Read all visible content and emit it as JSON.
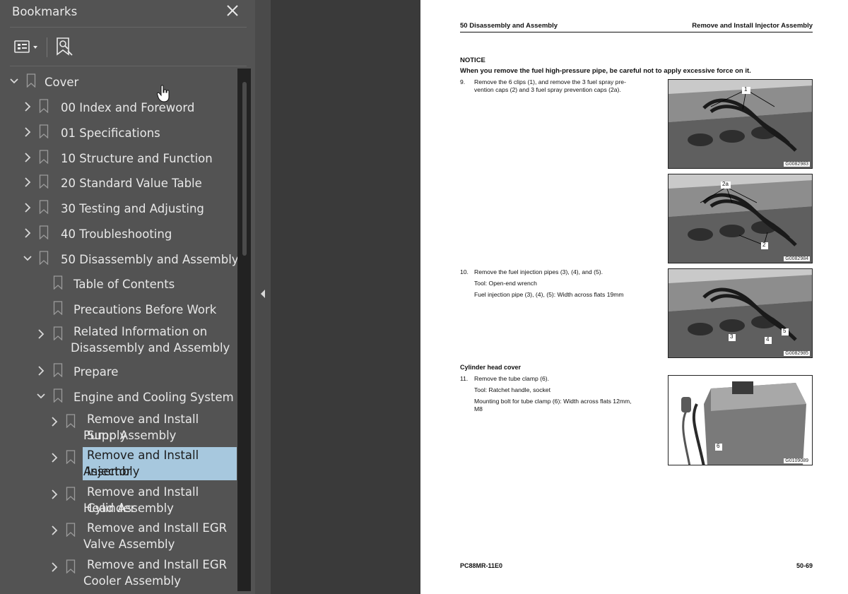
{
  "sidebar": {
    "title": "Bookmarks",
    "close_icon": "close-icon",
    "toolbar": {
      "options_icon": "bookmark-options-icon",
      "find_icon": "find-bookmark-icon"
    }
  },
  "bookmarks": [
    {
      "label": "Cover",
      "expanded": true
    },
    {
      "label": "00 Index and Foreword",
      "expanded": false
    },
    {
      "label": "01 Specifications",
      "expanded": false
    },
    {
      "label": "10 Structure and Function",
      "expanded": false
    },
    {
      "label": "20 Standard Value Table",
      "expanded": false
    },
    {
      "label": "30 Testing and Adjusting",
      "expanded": false
    },
    {
      "label": "40 Troubleshooting",
      "expanded": false
    },
    {
      "label": "50 Disassembly and Assembly",
      "expanded": true
    },
    {
      "label": "Table of Contents"
    },
    {
      "label": "Precautions Before Work"
    },
    {
      "label": "Related Information on Disassembly and Assembly",
      "line1": "Related Information on",
      "line2": "Disassembly and Assembly",
      "expanded": false
    },
    {
      "label": "Prepare",
      "expanded": false
    },
    {
      "label": "Engine and Cooling System",
      "expanded": true
    },
    {
      "line1": "Remove and Install Supply",
      "line2": "Pump Assembly",
      "expanded": false
    },
    {
      "line1": "Remove and Install Injector",
      "line2": "Assembly",
      "expanded": false,
      "selected": true
    },
    {
      "line1": "Remove and Install Cylinder",
      "line2": "Head Assembly",
      "expanded": false
    },
    {
      "line1": "Remove and Install EGR",
      "line2": "Valve Assembly",
      "expanded": false
    },
    {
      "line1": "Remove and Install EGR",
      "line2": "Cooler Assembly",
      "expanded": false
    }
  ],
  "page": {
    "header_left": "50 Disassembly and Assembly",
    "header_right": "Remove and Install Injector Assembly",
    "notice_title": "NOTICE",
    "notice_text": "When you remove the fuel high-pressure pipe, be careful not to apply excessive force on it.",
    "step9": {
      "num": "9.",
      "line1": "Remove the 6 clips (1), and remove the 3 fuel spray pre-",
      "line2": "vention caps (2) and 3 fuel spray prevention caps (2a)."
    },
    "step10": {
      "num": "10.",
      "line1": "Remove the fuel injection pipes (3), (4), and (5).",
      "line2": "Tool: Open-end wrench",
      "line3": "Fuel injection pipe (3), (4), (5): Width across flats 19mm"
    },
    "subhead": "Cylinder head cover",
    "step11": {
      "num": "11.",
      "line1": "Remove the tube clamp (6).",
      "line2": "Tool: Ratchet handle, socket",
      "line3": "Mounting bolt for tube clamp (6): Width across flats 12mm,",
      "line4": "M8"
    },
    "figures": [
      {
        "code": "G0082983",
        "callouts": [
          "1"
        ]
      },
      {
        "code": "G0082984",
        "callouts": [
          "2a",
          "2"
        ]
      },
      {
        "code": "G0082985",
        "callouts": [
          "3",
          "4",
          "5"
        ]
      },
      {
        "code": "G0109089",
        "callouts": [
          "6"
        ]
      }
    ],
    "footer_left": "PC88MR-11E0",
    "footer_right": "50-69"
  }
}
